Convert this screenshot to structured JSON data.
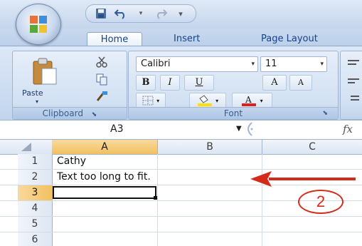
{
  "tabs": {
    "home": "Home",
    "insert": "Insert",
    "page_layout": "Page Layout"
  },
  "ribbon": {
    "clipboard": {
      "paste_label": "Paste",
      "group_label": "Clipboard"
    },
    "font": {
      "font_name": "Calibri",
      "font_size": "11",
      "bold": "B",
      "italic": "I",
      "underline": "U",
      "grow": "A",
      "shrink": "A",
      "group_label": "Font"
    }
  },
  "formula_bar": {
    "name_box": "A3",
    "fx": "fx"
  },
  "grid": {
    "columns": [
      "A",
      "B",
      "C"
    ],
    "rows": [
      {
        "num": "1",
        "a": "Cathy"
      },
      {
        "num": "2",
        "a": "Text too long to fit."
      },
      {
        "num": "3",
        "a": ""
      },
      {
        "num": "4",
        "a": ""
      },
      {
        "num": "5",
        "a": ""
      },
      {
        "num": "6",
        "a": ""
      }
    ],
    "selected_cell": "A3"
  },
  "annotation": {
    "callout_number": "2"
  },
  "colors": {
    "annotation_red": "#d42a1b",
    "selection_orange": "#f1c15f",
    "ribbon_blue": "#c2d5ee"
  }
}
